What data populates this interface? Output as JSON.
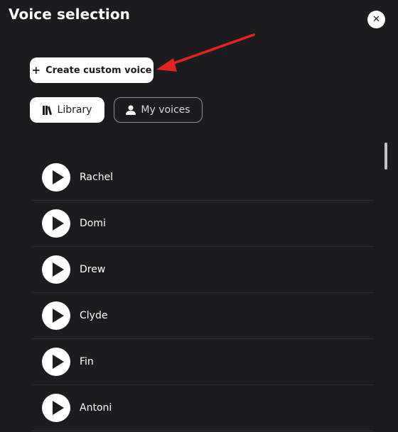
{
  "header": {
    "title": "Voice selection",
    "close_icon": "close-icon"
  },
  "actions": {
    "create_label": "Create custom voice",
    "create_icon": "plus-icon"
  },
  "tabs": [
    {
      "label": "Library",
      "icon": "library-icon",
      "selected": true
    },
    {
      "label": "My voices",
      "icon": "user-icon",
      "selected": false
    }
  ],
  "voices": [
    {
      "name": "Rachel"
    },
    {
      "name": "Domi"
    },
    {
      "name": "Drew"
    },
    {
      "name": "Clyde"
    },
    {
      "name": "Fin"
    },
    {
      "name": "Antoni"
    }
  ],
  "colors": {
    "background": "#1c1c1f",
    "accent_arrow": "#e52222",
    "button": "#ffffff"
  }
}
